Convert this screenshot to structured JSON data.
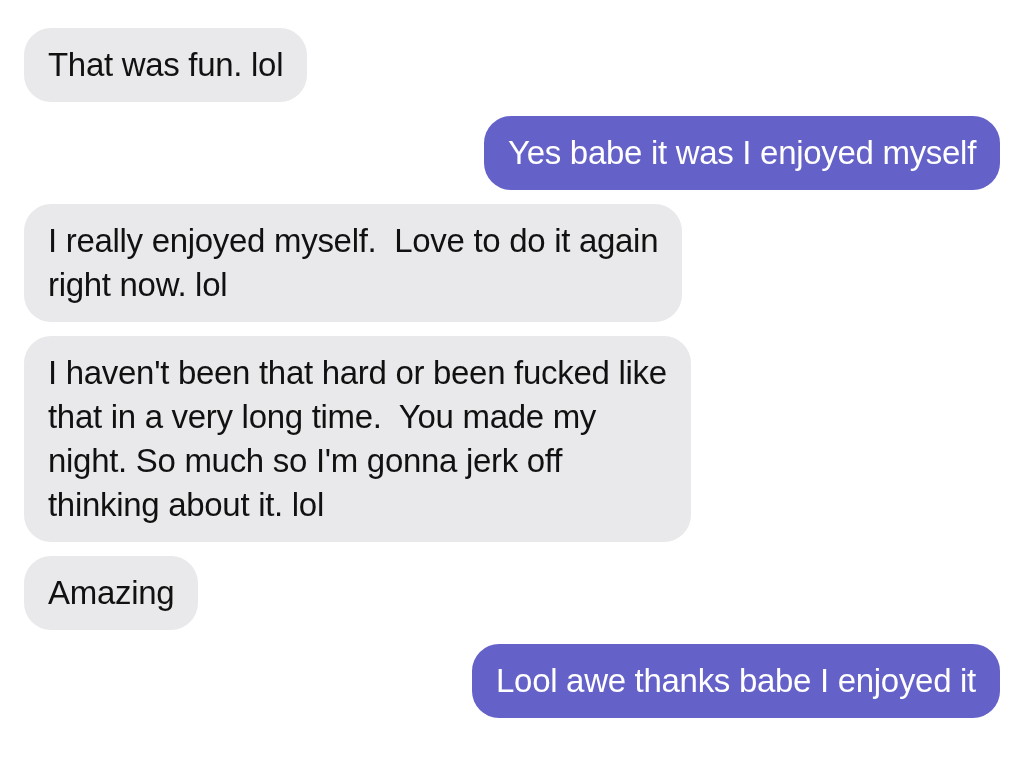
{
  "messages": [
    {
      "kind": "received",
      "text": "That was fun. lol"
    },
    {
      "kind": "sent",
      "text": "Yes babe it was I enjoyed myself"
    },
    {
      "kind": "received",
      "text": "I really enjoyed myself.  Love to do it again\nright now. lol"
    },
    {
      "kind": "received",
      "text": "I haven't been that hard or been fucked like\nthat in a very long time.  You made my\nnight. So much so I'm gonna jerk off\nthinking about it. lol"
    },
    {
      "kind": "received",
      "text": "Amazing"
    },
    {
      "kind": "sent",
      "text": "Lool awe thanks babe I enjoyed it"
    }
  ]
}
